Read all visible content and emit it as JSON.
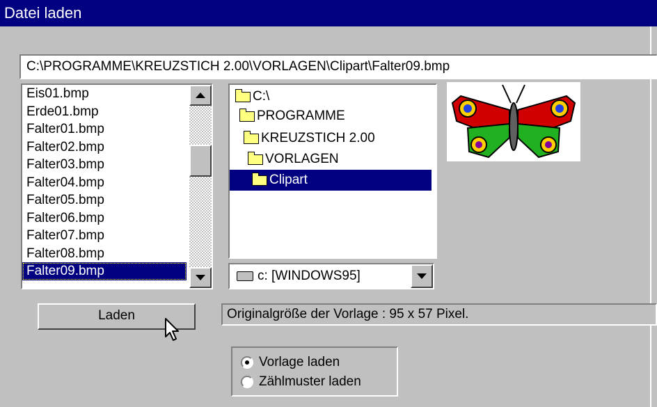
{
  "window": {
    "title": "Datei laden"
  },
  "path_field": {
    "value": "C:\\PROGRAMME\\KREUZSTICH 2.00\\VORLAGEN\\Clipart\\Falter09.bmp"
  },
  "file_list": {
    "items": [
      "Eis01.bmp",
      "Erde01.bmp",
      "Falter01.bmp",
      "Falter02.bmp",
      "Falter03.bmp",
      "Falter04.bmp",
      "Falter05.bmp",
      "Falter06.bmp",
      "Falter07.bmp",
      "Falter08.bmp",
      "Falter09.bmp"
    ],
    "selected": "Falter09.bmp"
  },
  "dir_tree": {
    "items": [
      "C:\\",
      "PROGRAMME",
      "KREUZSTICH 2.00",
      "VORLAGEN",
      "Clipart"
    ],
    "selected": "Clipart"
  },
  "drive": {
    "value": "c: [WINDOWS95]"
  },
  "preview": {
    "subject": "butterfly"
  },
  "buttons": {
    "load_label": "Laden"
  },
  "info": {
    "text": "Originalgröße der Vorlage : 95 x 57 Pixel."
  },
  "options": {
    "items": [
      "Vorlage laden",
      "Zählmuster laden"
    ],
    "selected": "Vorlage laden"
  },
  "colors": {
    "titlebar": "#000080",
    "selection": "#000080",
    "face": "#c0c0c0"
  }
}
